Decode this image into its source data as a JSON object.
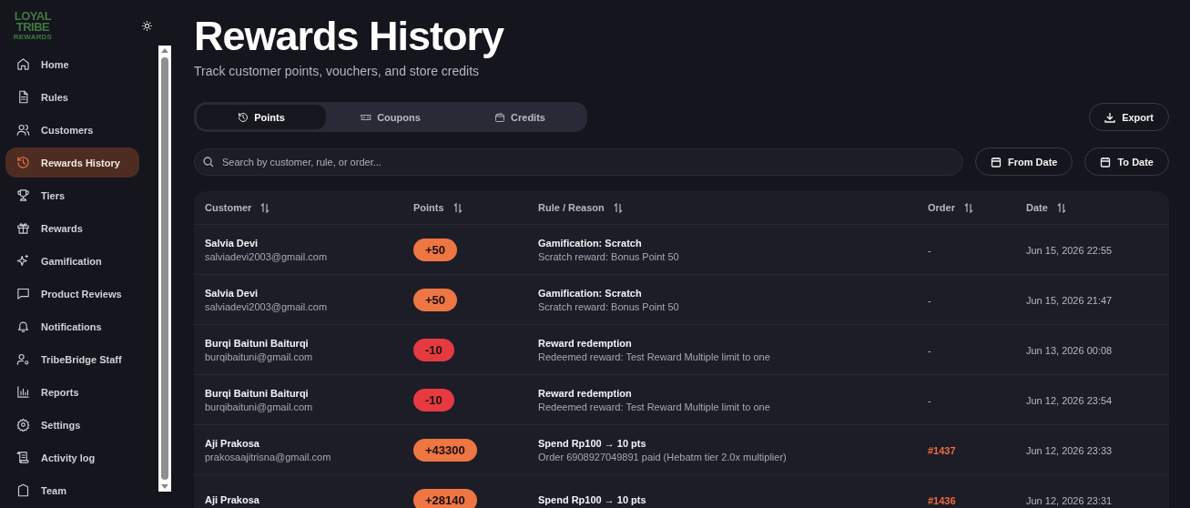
{
  "logo": {
    "line_1": "LOYAL",
    "line_2": "TRIBE",
    "line_3": "REWARDS"
  },
  "sidebar": {
    "items": [
      {
        "label": "Home",
        "selected": false
      },
      {
        "label": "Rules",
        "selected": false
      },
      {
        "label": "Customers",
        "selected": false
      },
      {
        "label": "Rewards History",
        "selected": true
      },
      {
        "label": "Tiers",
        "selected": false
      },
      {
        "label": "Rewards",
        "selected": false
      },
      {
        "label": "Gamification",
        "selected": false
      },
      {
        "label": "Product Reviews",
        "selected": false
      },
      {
        "label": "Notifications",
        "selected": false
      },
      {
        "label": "TribeBridge Staff",
        "selected": false
      },
      {
        "label": "Reports",
        "selected": false
      },
      {
        "label": "Settings",
        "selected": false
      },
      {
        "label": "Activity log",
        "selected": false
      },
      {
        "label": "Team",
        "selected": false
      }
    ]
  },
  "header": {
    "title": "Rewards History",
    "subtitle": "Track customer points, vouchers, and store credits"
  },
  "tabs": [
    {
      "label": "Points",
      "selected": true
    },
    {
      "label": "Coupons",
      "selected": false
    },
    {
      "label": "Credits",
      "selected": false
    }
  ],
  "export_button": "Export",
  "search": {
    "placeholder": "Search by customer, rule, or order..."
  },
  "date_buttons": [
    "From Date",
    "To Date"
  ],
  "table": {
    "columns": [
      "Customer",
      "Points",
      "Rule / Reason",
      "Order",
      "Date"
    ],
    "rows": [
      {
        "name": "Salvia Devi",
        "email": "salviadevi2003@gmail.com",
        "points": "+50",
        "color": "#ee7642",
        "rule": "Gamification: Scratch",
        "reason": "Scratch reward: Bonus Point 50",
        "order": "-",
        "order_linked": false,
        "date": "Jun 15, 2026 22:55"
      },
      {
        "name": "Salvia Devi",
        "email": "salviadevi2003@gmail.com",
        "points": "+50",
        "color": "#ee7642",
        "rule": "Gamification: Scratch",
        "reason": "Scratch reward: Bonus Point 50",
        "order": "-",
        "order_linked": false,
        "date": "Jun 15, 2026 21:47"
      },
      {
        "name": "Burqi Baituni Baiturqi",
        "email": "burqibaituni@gmail.com",
        "points": "-10",
        "color": "#e63a40",
        "rule": "Reward redemption",
        "reason": "Redeemed reward: Test Reward Multiple limit to one",
        "order": "-",
        "order_linked": false,
        "date": "Jun 13, 2026 00:08"
      },
      {
        "name": "Burqi Baituni Baiturqi",
        "email": "burqibaituni@gmail.com",
        "points": "-10",
        "color": "#e63a40",
        "rule": "Reward redemption",
        "reason": "Redeemed reward: Test Reward Multiple limit to one",
        "order": "-",
        "order_linked": false,
        "date": "Jun 12, 2026 23:54"
      },
      {
        "name": "Aji Prakosa",
        "email": "prakosaajitrisna@gmail.com",
        "points": "+43300",
        "color": "#ee7642",
        "rule": "Spend Rp100 → 10 pts",
        "reason": "Order 6908927049891 paid (Hebatm tier 2.0x multiplier)",
        "order": "#1437",
        "order_linked": true,
        "date": "Jun 12, 2026 23:33"
      },
      {
        "name": "Aji Prakosa",
        "points": "+28140",
        "color": "#ee7642",
        "rule": "Spend Rp100 → 10 pts",
        "order": "#1436",
        "order_linked": true,
        "date": "Jun 12, 2026 23:31"
      }
    ]
  }
}
